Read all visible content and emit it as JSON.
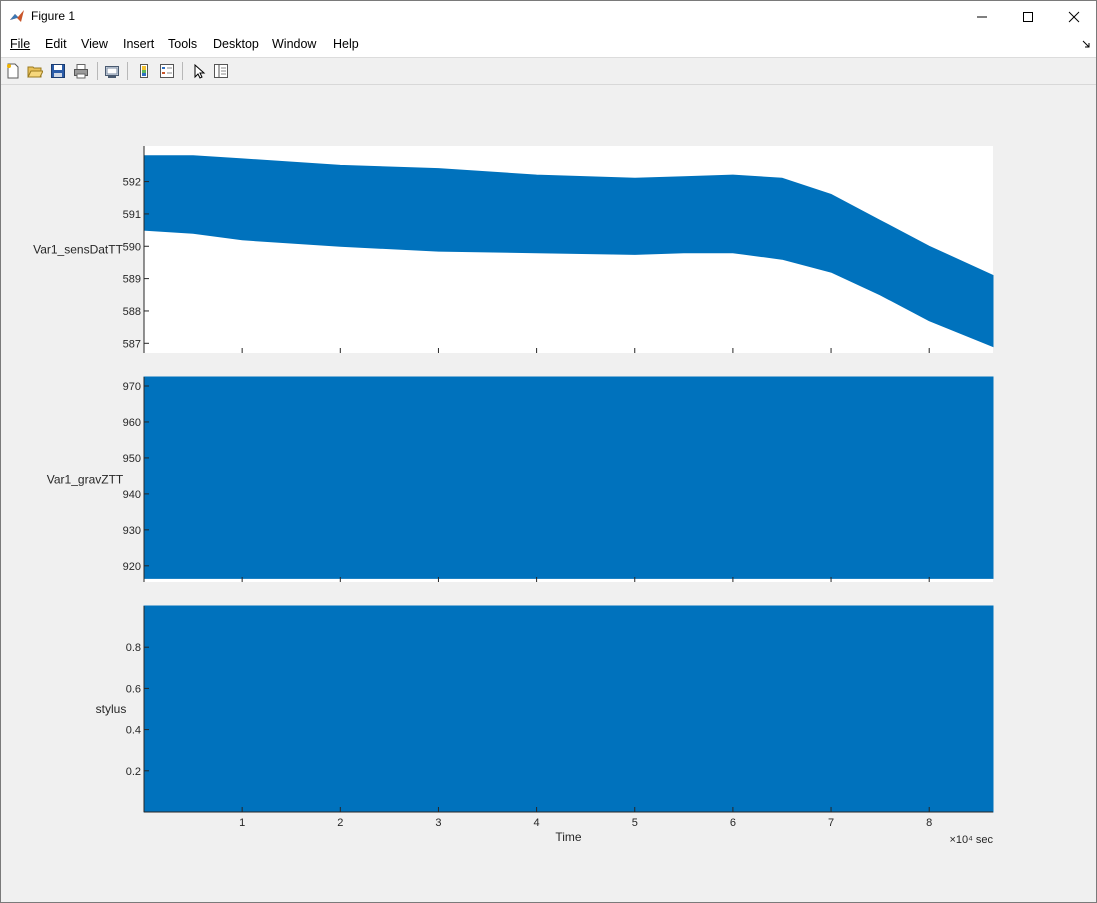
{
  "window": {
    "title": "Figure 1",
    "menus": [
      "File",
      "Edit",
      "View",
      "Insert",
      "Tools",
      "Desktop",
      "Window",
      "Help"
    ],
    "toolbar_icons": [
      "new-figure-icon",
      "open-file-icon",
      "save-icon",
      "print-icon",
      "link-plot-icon",
      "colorbar-icon",
      "legend-icon",
      "pointer-icon",
      "property-inspector-icon"
    ]
  },
  "colors": {
    "series": "#0072bd",
    "figure_bg": "#f0f0f0",
    "axes_bg": "#ffffff"
  },
  "chart_data": [
    {
      "type": "area",
      "ylabel": "Var1_sensDatTT",
      "xlabel": "",
      "x_exponent_label": "×10⁴ sec",
      "xlim": [
        0,
        8.65
      ],
      "ylim": [
        586.7,
        593.1
      ],
      "y_ticks": [
        587,
        588,
        589,
        590,
        591,
        592
      ],
      "x_ticks": [
        1,
        2,
        3,
        4,
        5,
        6,
        7,
        8
      ],
      "x": [
        0,
        0.5,
        1,
        2,
        3,
        4,
        5,
        5.5,
        6,
        6.5,
        7,
        7.5,
        8,
        8.65
      ],
      "upper": [
        592.8,
        592.8,
        592.7,
        592.5,
        592.4,
        592.2,
        592.1,
        592.15,
        592.2,
        592.1,
        591.6,
        590.8,
        590.0,
        589.1
      ],
      "lower": [
        590.5,
        590.4,
        590.2,
        590.0,
        589.85,
        589.8,
        589.75,
        589.8,
        589.8,
        589.6,
        589.2,
        588.5,
        587.7,
        586.9
      ]
    },
    {
      "type": "area",
      "ylabel": "Var1_gravZTT",
      "xlabel": "",
      "xlim": [
        0,
        8.65
      ],
      "ylim": [
        915.5,
        972.5
      ],
      "y_ticks": [
        920,
        930,
        940,
        950,
        960,
        970
      ],
      "x_ticks": [
        1,
        2,
        3,
        4,
        5,
        6,
        7,
        8
      ],
      "x": [
        0,
        8.65
      ],
      "upper": [
        972.5,
        972.5
      ],
      "lower": [
        916.5,
        916.5
      ]
    },
    {
      "type": "area",
      "ylabel": "stylus",
      "xlabel": "Time",
      "x_exponent_label": "×10⁴ sec",
      "xlim": [
        0,
        8.65
      ],
      "ylim": [
        0,
        1
      ],
      "y_ticks": [
        0.2,
        0.4,
        0.6,
        0.8
      ],
      "x_ticks": [
        1,
        2,
        3,
        4,
        5,
        6,
        7,
        8
      ],
      "x": [
        0,
        8.65
      ],
      "upper": [
        1,
        1
      ],
      "lower": [
        0,
        0
      ]
    }
  ]
}
